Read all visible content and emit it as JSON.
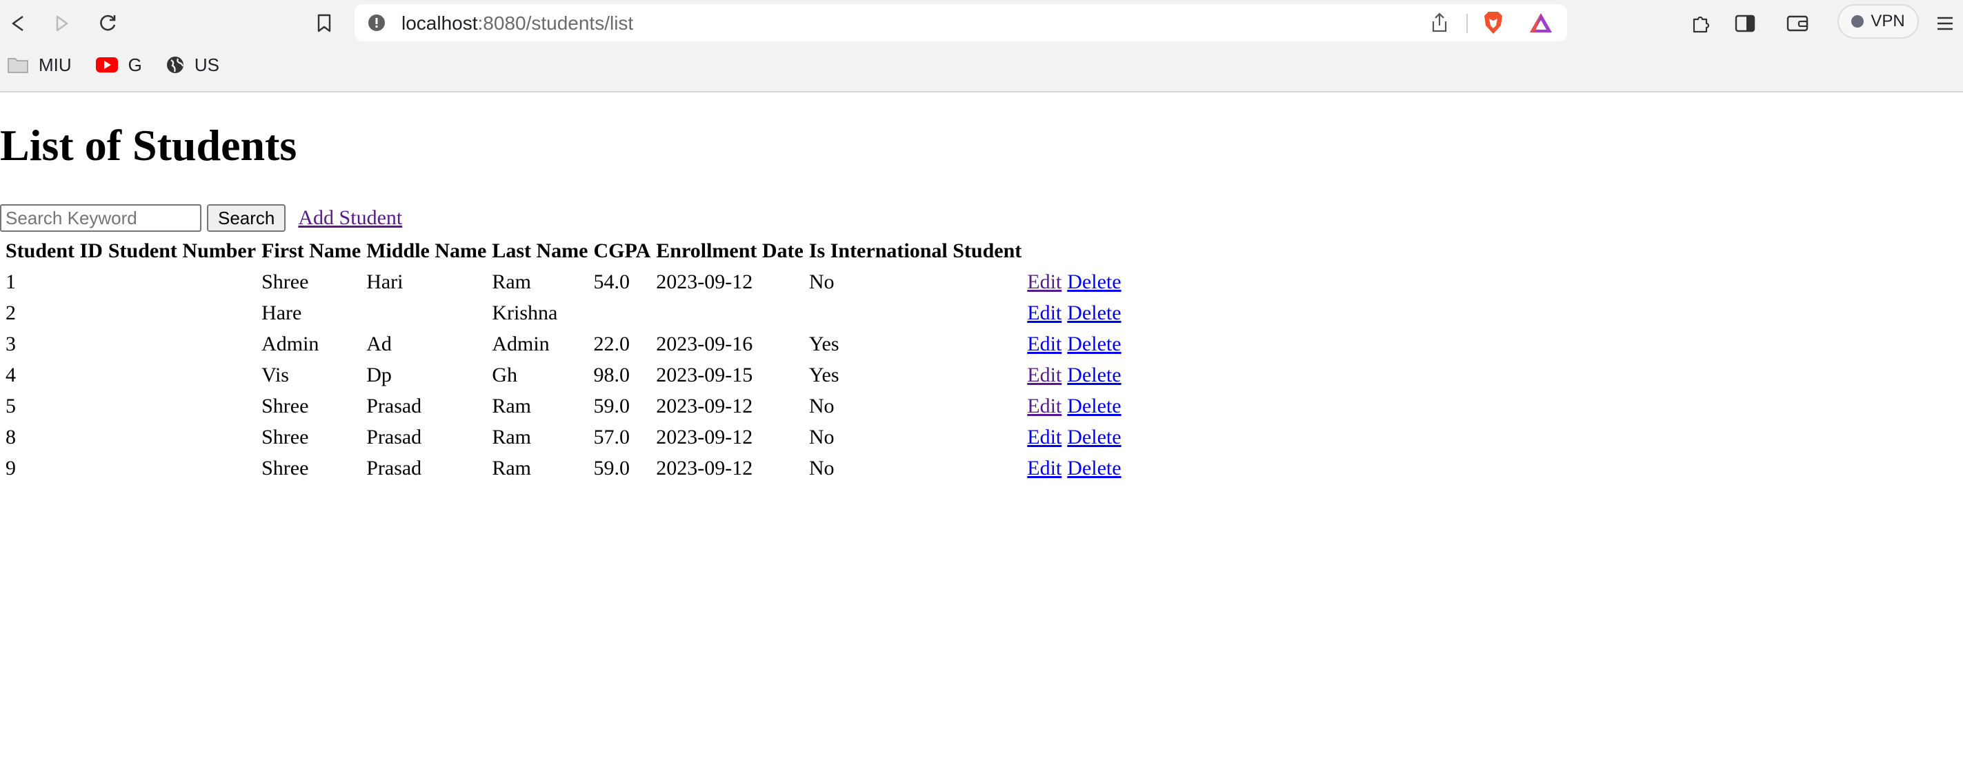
{
  "browser": {
    "url_host": "localhost",
    "url_path": ":8080/students/list",
    "vpn_label": "VPN",
    "bookmarks": [
      {
        "label": "MIU",
        "icon": "folder-icon"
      },
      {
        "label": "G",
        "icon": "youtube-icon"
      },
      {
        "label": "US",
        "icon": "globe-icon"
      }
    ]
  },
  "page": {
    "title": "List of Students",
    "search_placeholder": "Search Keyword",
    "search_button": "Search",
    "add_link": "Add Student",
    "edit_label": "Edit",
    "delete_label": "Delete"
  },
  "table": {
    "headers": [
      "Student ID",
      "Student Number",
      "First Name",
      "Middle Name",
      "Last Name",
      "CGPA",
      "Enrollment Date",
      "Is International Student"
    ],
    "rows": [
      {
        "id": "1",
        "number": "",
        "first": "Shree",
        "middle": "Hari",
        "last": "Ram",
        "cgpa": "54.0",
        "date": "2023-09-12",
        "intl": "No",
        "edit_visited": true
      },
      {
        "id": "2",
        "number": "",
        "first": "Hare",
        "middle": "",
        "last": "Krishna",
        "cgpa": "",
        "date": "",
        "intl": "",
        "edit_visited": false
      },
      {
        "id": "3",
        "number": "",
        "first": "Admin",
        "middle": "Ad",
        "last": "Admin",
        "cgpa": "22.0",
        "date": "2023-09-16",
        "intl": "Yes",
        "edit_visited": false
      },
      {
        "id": "4",
        "number": "",
        "first": "Vis",
        "middle": "Dp",
        "last": "Gh",
        "cgpa": "98.0",
        "date": "2023-09-15",
        "intl": "Yes",
        "edit_visited": true
      },
      {
        "id": "5",
        "number": "",
        "first": "Shree",
        "middle": "Prasad",
        "last": "Ram",
        "cgpa": "59.0",
        "date": "2023-09-12",
        "intl": "No",
        "edit_visited": true
      },
      {
        "id": "8",
        "number": "",
        "first": "Shree",
        "middle": "Prasad",
        "last": "Ram",
        "cgpa": "57.0",
        "date": "2023-09-12",
        "intl": "No",
        "edit_visited": false
      },
      {
        "id": "9",
        "number": "",
        "first": "Shree",
        "middle": "Prasad",
        "last": "Ram",
        "cgpa": "59.0",
        "date": "2023-09-12",
        "intl": "No",
        "edit_visited": false
      }
    ]
  },
  "colors": {
    "link": "#0000ee",
    "visited": "#551a8b"
  }
}
